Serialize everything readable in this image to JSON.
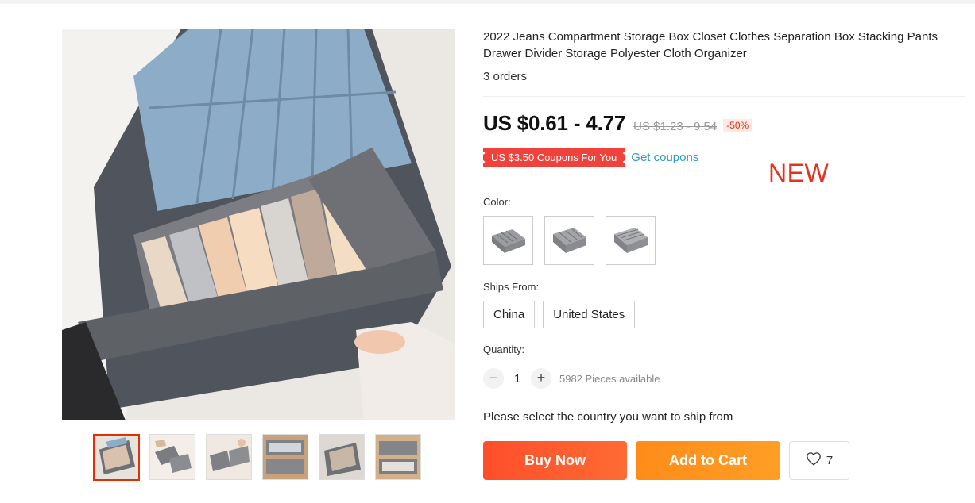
{
  "product": {
    "title": "2022 Jeans Compartment Storage Box Closet Clothes Separation Box Stacking Pants Drawer Divider Storage Polyester Cloth Organizer",
    "orders": "3 orders",
    "price": "US $0.61 - 4.77",
    "original_price": "US $1.23 - 9.54",
    "discount": "-50%",
    "coupon_badge": "US $3.50 Coupons For You",
    "get_coupons": "Get coupons",
    "new_label": "NEW"
  },
  "options": {
    "color_label": "Color:",
    "color_count": 3,
    "ships_from_label": "Ships From:",
    "ships_from": [
      "China",
      "United States"
    ]
  },
  "quantity": {
    "label": "Quantity:",
    "minus": "−",
    "value": "1",
    "plus": "+",
    "available": "5982 Pieces available"
  },
  "actions": {
    "ship_note": "Please select the country you want to ship from",
    "buy_now": "Buy Now",
    "add_to_cart": "Add to Cart",
    "wishlist_count": "7"
  },
  "gallery": {
    "thumbnail_count": 6,
    "active_index": 0
  },
  "colors": {
    "accent": "#e62e04",
    "buy_now": "#ff4e2b",
    "add_to_cart": "#ff9320",
    "coupon": "#f0423a",
    "link": "#2e9cc3",
    "new_label": "#e5321f"
  },
  "icons": {
    "wishlist": "heart-icon"
  }
}
